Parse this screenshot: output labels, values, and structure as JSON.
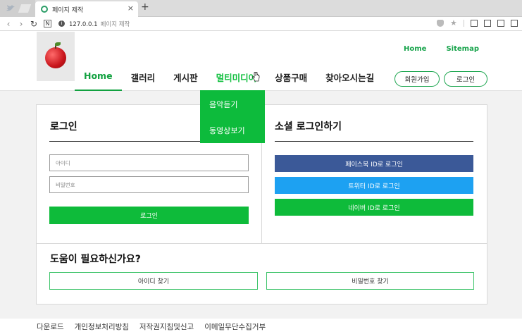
{
  "browser": {
    "tab_title": "페이지 제작",
    "tab_close": "×",
    "new_tab": "+",
    "url": "127.0.0.1",
    "url_page_name": "페이지 제작",
    "back": "‹",
    "forward": "›",
    "reload": "↻",
    "n_badge": "N",
    "info": "i",
    "star": "★"
  },
  "header": {
    "top_links": [
      "Home",
      "Sitemap"
    ],
    "nav": [
      "Home",
      "갤러리",
      "게시판",
      "멀티미디어",
      "상품구매",
      "찾아오시는길"
    ],
    "join_label": "회원가입",
    "login_label": "로그인"
  },
  "dropdown": [
    "음악듣기",
    "동영상보기"
  ],
  "login_section": {
    "title": "로그인",
    "id_placeholder": "아이디",
    "pw_placeholder": "비밀번호",
    "login_button": "로그인"
  },
  "social_section": {
    "title": "소셜 로그인하기",
    "facebook": "페이스북 ID로 로그인",
    "twitter": "트위터 ID로 로그인",
    "naver": "네이버 ID로 로그인"
  },
  "help_section": {
    "title": "도움이 필요하신가요?",
    "find_id": "아이디 찾기",
    "find_pw": "비밀번호 찾기"
  },
  "footer": [
    "다운로드",
    "개인정보처리방침",
    "저작권지침및신고",
    "이메일무단수집거부"
  ],
  "colors": {
    "brand_green": "#0ebb3a",
    "facebook": "#3b5998",
    "twitter": "#1da1f2"
  }
}
